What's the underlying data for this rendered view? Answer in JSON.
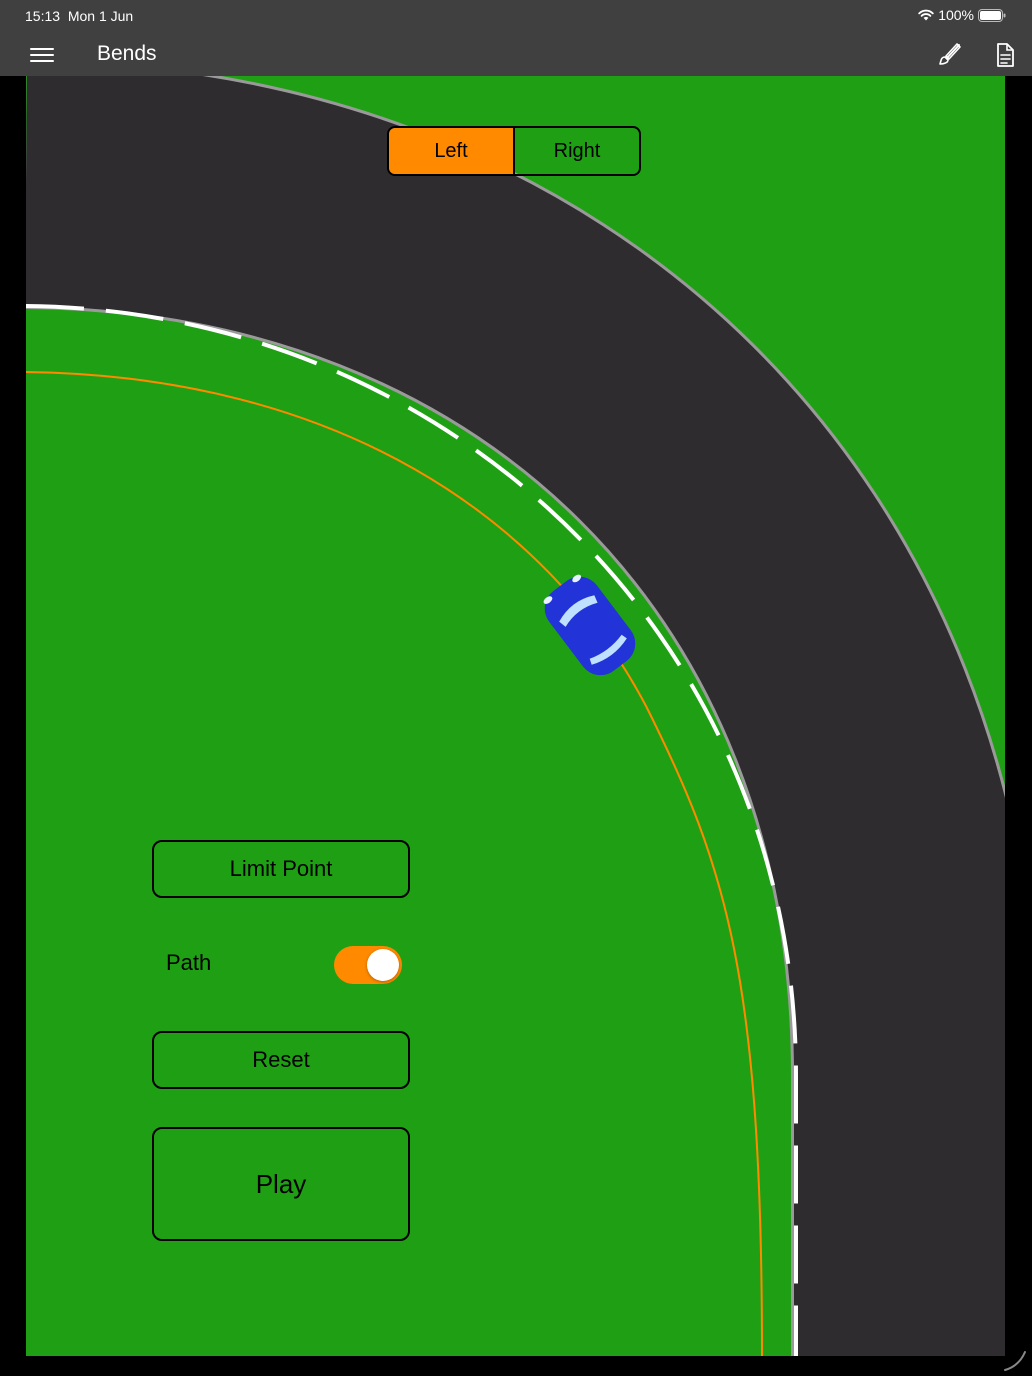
{
  "status": {
    "time": "15:13",
    "date": "Mon 1 Jun",
    "battery": "100%"
  },
  "nav": {
    "title": "Bends",
    "menu_icon": "hamburger-icon",
    "brush_icon": "paintbrush-icon",
    "doc_icon": "document-icon"
  },
  "segment": {
    "options": [
      "Left",
      "Right"
    ],
    "selected": "Left"
  },
  "controls": {
    "limit_point": "Limit Point",
    "path_label": "Path",
    "path_on": true,
    "reset": "Reset",
    "play": "Play"
  },
  "colors": {
    "grass": "#1fa014",
    "road": "#2e2c2e",
    "accent": "#ff8a00",
    "car": "#2233d8",
    "bar": "#404040"
  }
}
